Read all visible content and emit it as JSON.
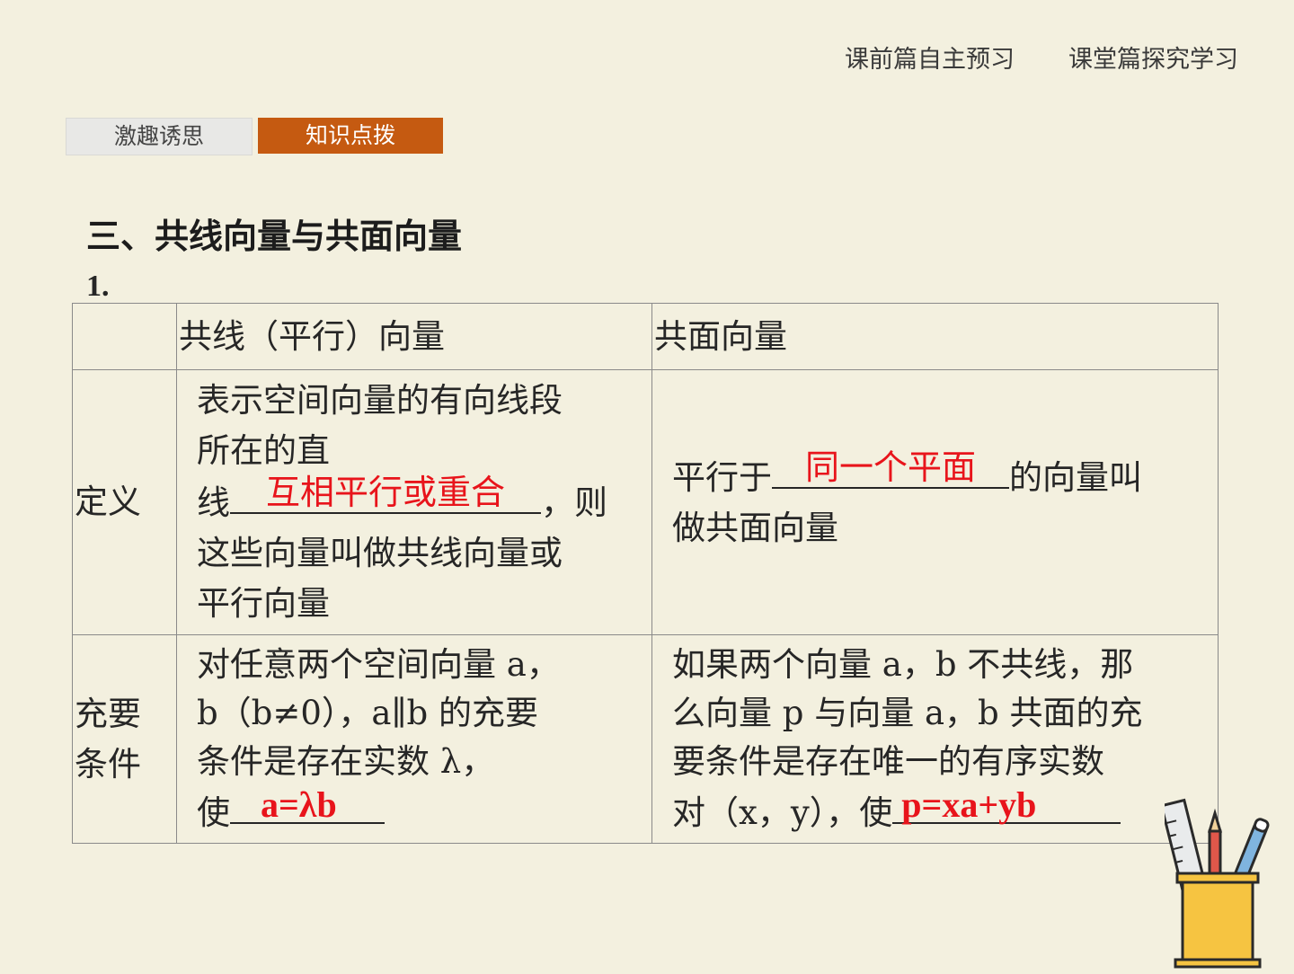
{
  "top_nav": {
    "left": "课前篇自主预习",
    "right": "课堂篇探究学习"
  },
  "tabs": {
    "inactive": "激趣诱思",
    "active": "知识点拨"
  },
  "heading": "三、共线向量与共面向量",
  "item_number": "1.",
  "table": {
    "header": {
      "c1": "",
      "c2": "共线（平行）向量",
      "c3": "共面向量"
    },
    "row_def": {
      "label": "定义",
      "c2_line1": "表示空间向量的有向线段",
      "c2_line2": "所在的直",
      "c2_line3a": "线",
      "c2_answer": "互相平行或重合",
      "c2_line3b": "，则",
      "c2_line4": "这些向量叫做共线向量或",
      "c2_line5": "平行向量",
      "c3_pre": "平行于",
      "c3_answer": "同一个平面",
      "c3_post": "的向量叫",
      "c3_line2": "做共面向量"
    },
    "row_cond": {
      "label_line1": "充要",
      "label_line2": "条件",
      "c2_line1": "对任意两个空间向量 a，",
      "c2_line2": "b（b≠0），a∥b 的充要",
      "c2_line3": "条件是存在实数 λ，",
      "c2_line4": "使",
      "c2_answer": "a=λb",
      "c3_line1": "如果两个向量 a，b 不共线，那",
      "c3_line2": "么向量 p 与向量 a，b 共面的充",
      "c3_line3": "要条件是存在唯一的有序实数",
      "c3_line4": "对（x，y），使",
      "c3_answer": "p=xa+yb"
    }
  },
  "colors": {
    "accent": "#c55a11",
    "answer": "#e8141b",
    "background": "#f3f0df"
  },
  "decoration": {
    "icon": "pencil-cup-icon"
  }
}
